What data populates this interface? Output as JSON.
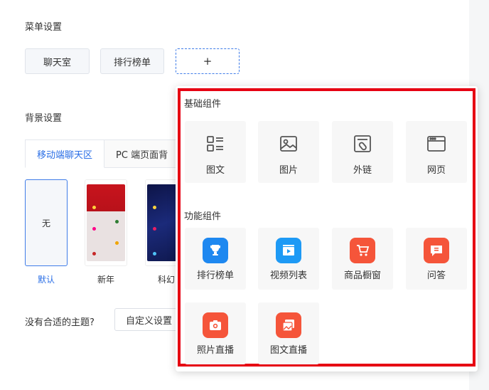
{
  "menu": {
    "title": "菜单设置",
    "items": [
      "聊天室",
      "排行榜单"
    ],
    "add_label": "+"
  },
  "background": {
    "title": "背景设置",
    "tabs": [
      "移动端聊天区",
      "PC 端页面背"
    ],
    "themes": [
      {
        "thumb_text": "无",
        "caption": "默认"
      },
      {
        "caption": "新年"
      },
      {
        "caption": "科幻"
      }
    ]
  },
  "no_theme": {
    "text": "没有合适的主题?",
    "button": "自定义设置"
  },
  "popover": {
    "basic_title": "基础组件",
    "basic": [
      {
        "label": "图文",
        "icon": "list-icon"
      },
      {
        "label": "图片",
        "icon": "image-icon"
      },
      {
        "label": "外链",
        "icon": "link-icon"
      },
      {
        "label": "网页",
        "icon": "browser-icon"
      }
    ],
    "func_title": "功能组件",
    "func": [
      {
        "label": "排行榜单",
        "icon": "trophy-icon",
        "color": "#1e88f0"
      },
      {
        "label": "视频列表",
        "icon": "video-icon",
        "color": "#1e9af5"
      },
      {
        "label": "商品橱窗",
        "icon": "cart-icon",
        "color": "#f5553a"
      },
      {
        "label": "问答",
        "icon": "qa-icon",
        "color": "#f5553a"
      },
      {
        "label": "照片直播",
        "icon": "camera-icon",
        "color": "#f5553a"
      },
      {
        "label": "图文直播",
        "icon": "gallery-icon",
        "color": "#f5553a"
      }
    ],
    "highlight_color": "#e60012"
  }
}
